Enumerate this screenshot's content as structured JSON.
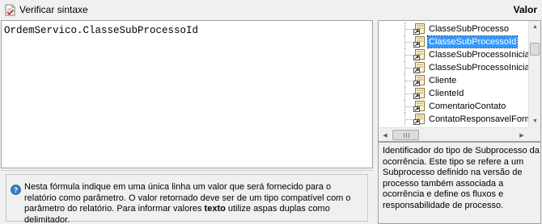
{
  "toolbar": {
    "check_syntax_label": "Verificar sintaxe",
    "check_icon": "document-check-icon"
  },
  "panel_title": "Valor",
  "editor": {
    "value": "OrdemServico.ClasseSubProcessoId"
  },
  "help": {
    "icon": "help-icon",
    "text_part1": "Nesta fórmula indique em uma única linha um valor que será fornecido para o relatório como parâmetro. O valor retornado deve ser de um tipo compatível com o parâmetro do relatório. Para informar valores ",
    "text_bold": "texto",
    "text_part2": " utilize aspas duplas como delimitador."
  },
  "tree": {
    "items": [
      {
        "label": "ClasseSubProcesso",
        "icon": "field-icon",
        "selected": false
      },
      {
        "label": "ClasseSubProcessoId",
        "icon": "field-icon",
        "selected": true
      },
      {
        "label": "ClasseSubProcessoIniciad",
        "icon": "field-icon",
        "selected": false
      },
      {
        "label": "ClasseSubProcessoIniciad",
        "icon": "field-icon",
        "selected": false
      },
      {
        "label": "Cliente",
        "icon": "field-icon",
        "selected": false
      },
      {
        "label": "ClienteId",
        "icon": "field-icon",
        "selected": false
      },
      {
        "label": "ComentarioContato",
        "icon": "field-icon",
        "selected": false
      },
      {
        "label": "ContatoResponsavelForm",
        "icon": "field-icon",
        "selected": false
      }
    ]
  },
  "description": "Identificador do tipo de Subprocesso da ocorrência. Este tipo se refere a um Subprocesso definido na versão de processo também associada a ocorrência e define os fluxos e responsabilidade de processo.",
  "colors": {
    "selection": "#3399ff",
    "background": "#f0f0f0"
  }
}
